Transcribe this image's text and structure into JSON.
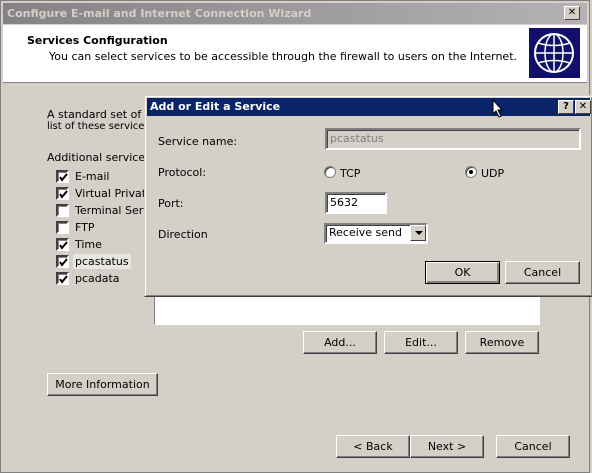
{
  "wizard": {
    "title": "Configure E-mail and Internet Connection Wizard",
    "close_glyph": "✕",
    "header": {
      "title": "Services Configuration",
      "subtitle": "You can select services to be accessible through the firewall to users on the Internet."
    },
    "intro_text_line1": "A standard set of ser",
    "intro_text_line2": "list of these services.",
    "services_label": "Additional services:",
    "services": [
      {
        "label": "E-mail",
        "checked": true
      },
      {
        "label": "Virtual Private I",
        "checked": true
      },
      {
        "label": "Terminal Servic",
        "checked": false
      },
      {
        "label": "FTP",
        "checked": false
      },
      {
        "label": "Time",
        "checked": true
      },
      {
        "label": "pcastatus",
        "checked": true
      },
      {
        "label": "pcadata",
        "checked": true
      }
    ],
    "buttons": {
      "add": "Add...",
      "edit": "Edit...",
      "remove": "Remove",
      "more_info": "More Information",
      "back": "< Back",
      "next": "Next >",
      "cancel": "Cancel"
    }
  },
  "dialog": {
    "title": "Add or Edit a Service",
    "help_glyph": "?",
    "close_glyph": "✕",
    "service_name_label": "Service name:",
    "service_name_value": "pcastatus",
    "protocol_label": "Protocol:",
    "protocol_options": [
      "TCP",
      "UDP"
    ],
    "protocol_selected": "UDP",
    "port_label": "Port:",
    "port_value": "5632",
    "direction_label": "Direction",
    "direction_value": "Receive send",
    "ok": "OK",
    "cancel": "Cancel"
  },
  "colors": {
    "dialog_titlebar": "#0a246a",
    "inactive_titlebar": "#848284",
    "face": "#d4d0c8"
  }
}
